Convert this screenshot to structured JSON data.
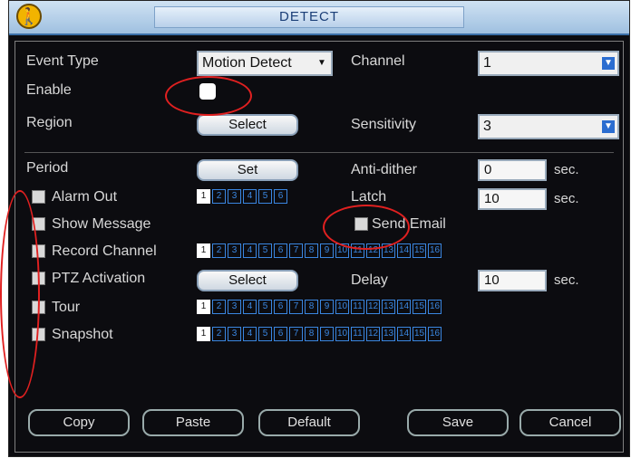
{
  "title": "DETECT",
  "title_icon": "running-man-icon",
  "labels": {
    "event_type": "Event Type",
    "enable": "Enable",
    "region": "Region",
    "channel": "Channel",
    "sensitivity": "Sensitivity",
    "period": "Period",
    "anti_dither": "Anti-dither",
    "latch": "Latch",
    "delay": "Delay",
    "alarm_out": "Alarm Out",
    "show_message": "Show Message",
    "send_email": "Send Email",
    "record_channel": "Record Channel",
    "ptz_activation": "PTZ Activation",
    "tour": "Tour",
    "snapshot": "Snapshot"
  },
  "fields": {
    "event_type_value": "Motion Detect",
    "channel_value": "1",
    "sensitivity_value": "3",
    "anti_dither_value": "0",
    "latch_value": "10",
    "delay_value": "10",
    "unit": "sec."
  },
  "buttons": {
    "region_select": "Select",
    "period_set": "Set",
    "ptz_select": "Select",
    "copy": "Copy",
    "paste": "Paste",
    "default": "Default",
    "save": "Save",
    "cancel": "Cancel"
  },
  "alarm_out_channels": [
    "1",
    "2",
    "3",
    "4",
    "5",
    "6"
  ],
  "record_channels": [
    "1",
    "2",
    "3",
    "4",
    "5",
    "6",
    "7",
    "8",
    "9",
    "10",
    "11",
    "12",
    "13",
    "14",
    "15",
    "16"
  ],
  "tour_channels": [
    "1",
    "2",
    "3",
    "4",
    "5",
    "6",
    "7",
    "8",
    "9",
    "10",
    "11",
    "12",
    "13",
    "14",
    "15",
    "16"
  ],
  "snapshot_channels": [
    "1",
    "2",
    "3",
    "4",
    "5",
    "6",
    "7",
    "8",
    "9",
    "10",
    "11",
    "12",
    "13",
    "14",
    "15",
    "16"
  ],
  "colors": {
    "background": "#0c0c10",
    "accent": "#3a86e0",
    "annotation": "#e02020"
  }
}
